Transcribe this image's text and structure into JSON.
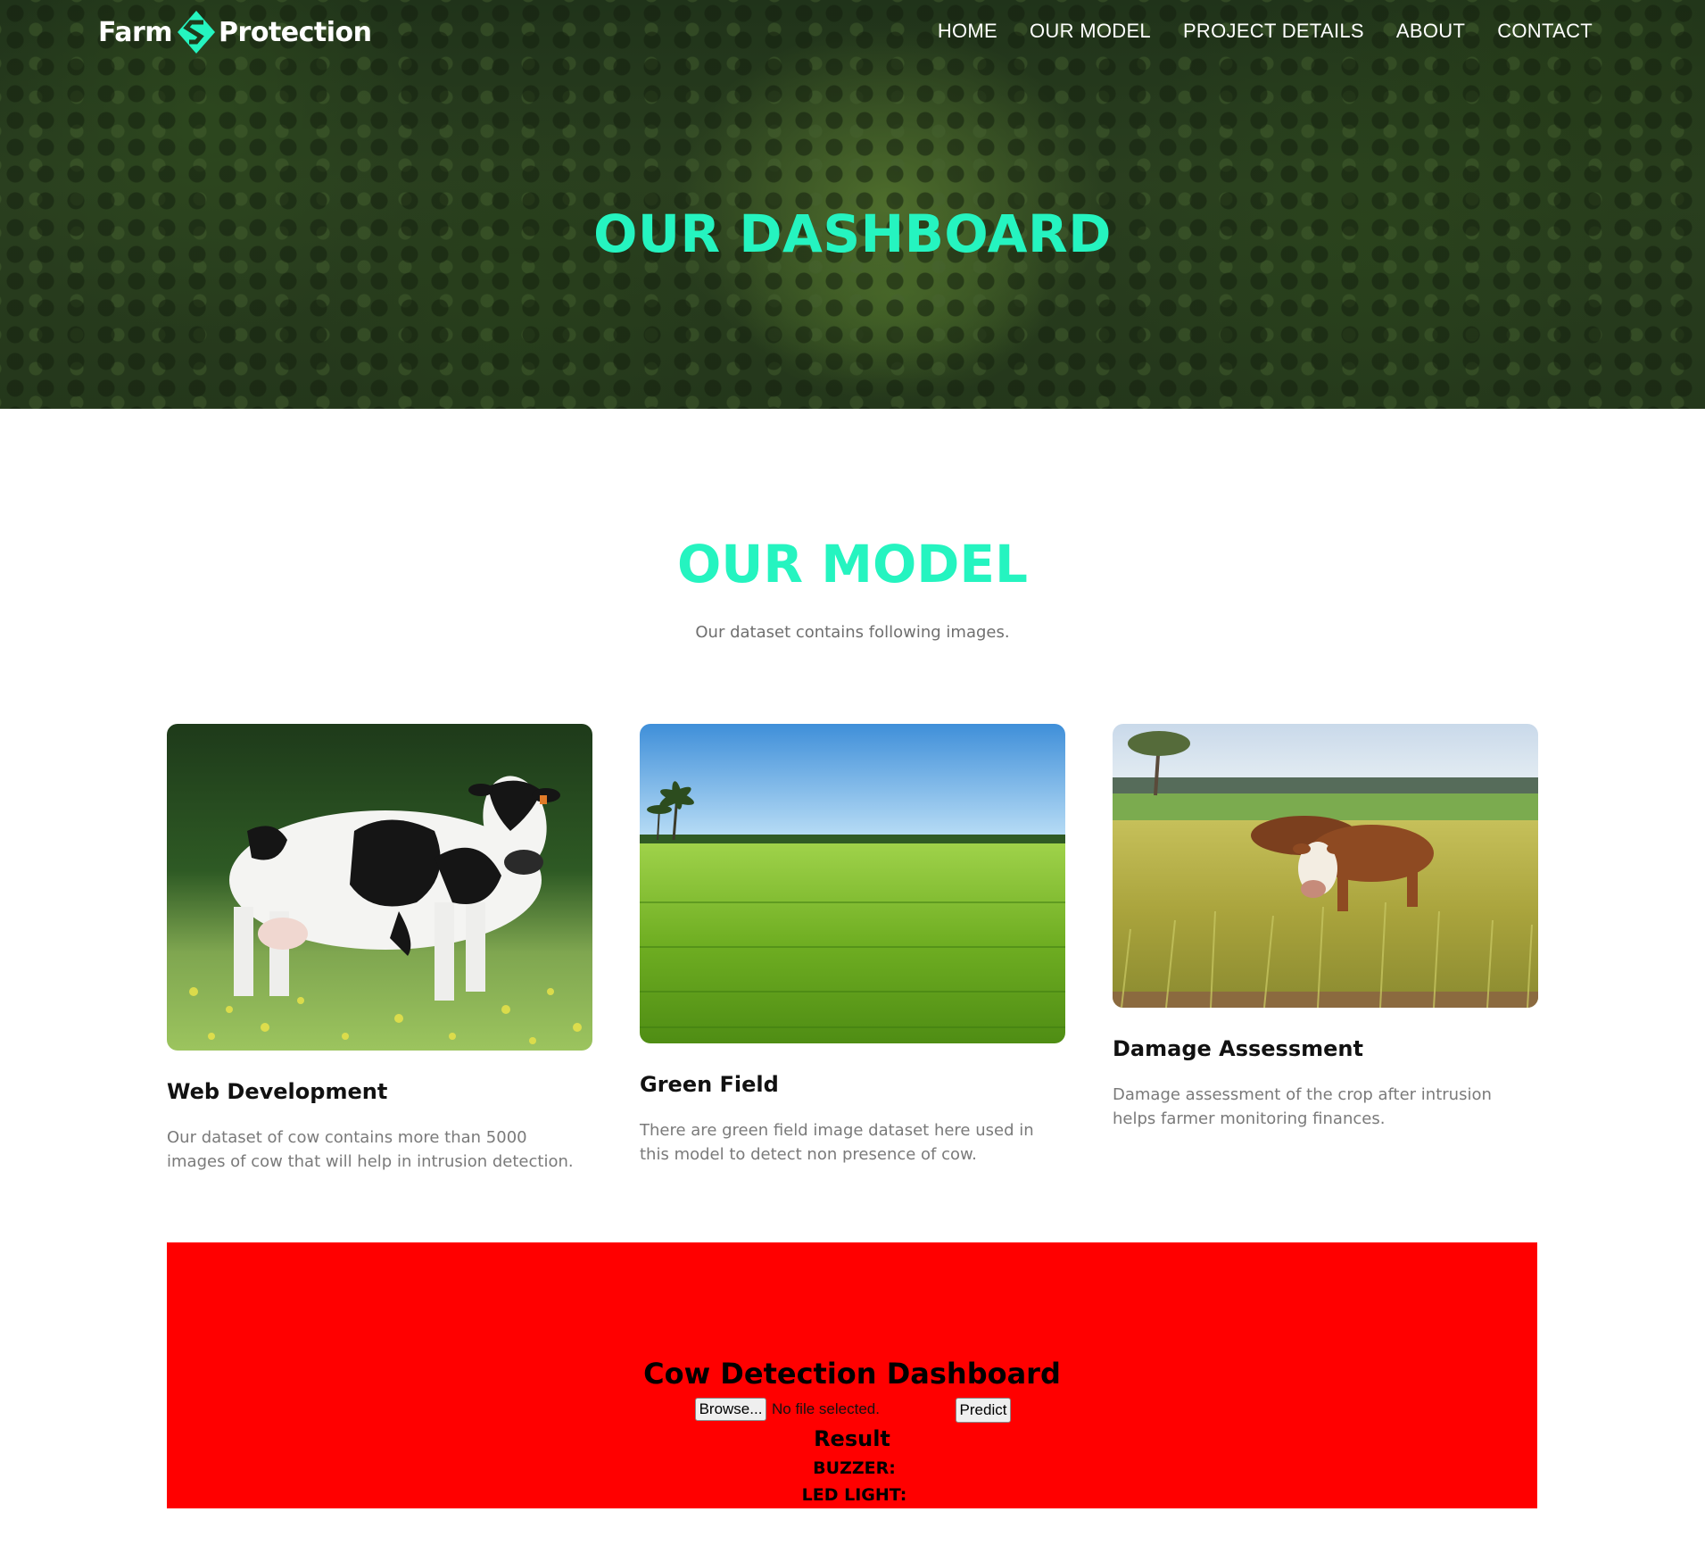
{
  "header": {
    "logo_left": "Farm",
    "logo_right": "Protection",
    "nav": [
      "HOME",
      "OUR MODEL",
      "PROJECT DETAILS",
      "ABOUT",
      "CONTACT"
    ]
  },
  "hero": {
    "title": "OUR DASHBOARD"
  },
  "model": {
    "title": "OUR MODEL",
    "subtitle": "Our dataset contains following images.",
    "cards": [
      {
        "title": "Web Development",
        "text": "Our dataset of cow contains more than 5000 images of cow that will help in intrusion detection.",
        "image": "cow-in-meadow"
      },
      {
        "title": "Green Field",
        "text": "There are green field image dataset here used in this model to detect non presence of cow.",
        "image": "green-rice-field"
      },
      {
        "title": "Damage Assessment",
        "text": "Damage assessment of the crop after intrusion helps farmer monitoring finances.",
        "image": "cows-grazing-crop"
      }
    ]
  },
  "dashboard": {
    "title": "Cow Detection Dashboard",
    "browse_label": "Browse...",
    "file_status": "No file selected.",
    "predict_label": "Predict",
    "result_title": "Result",
    "buzzer_label": "BUZZER:",
    "led_label": "LED LIGHT:"
  },
  "colors": {
    "accent": "#25f4c0",
    "dashboard_bg": "#ff0000",
    "body_text": "#7a7a7a"
  }
}
